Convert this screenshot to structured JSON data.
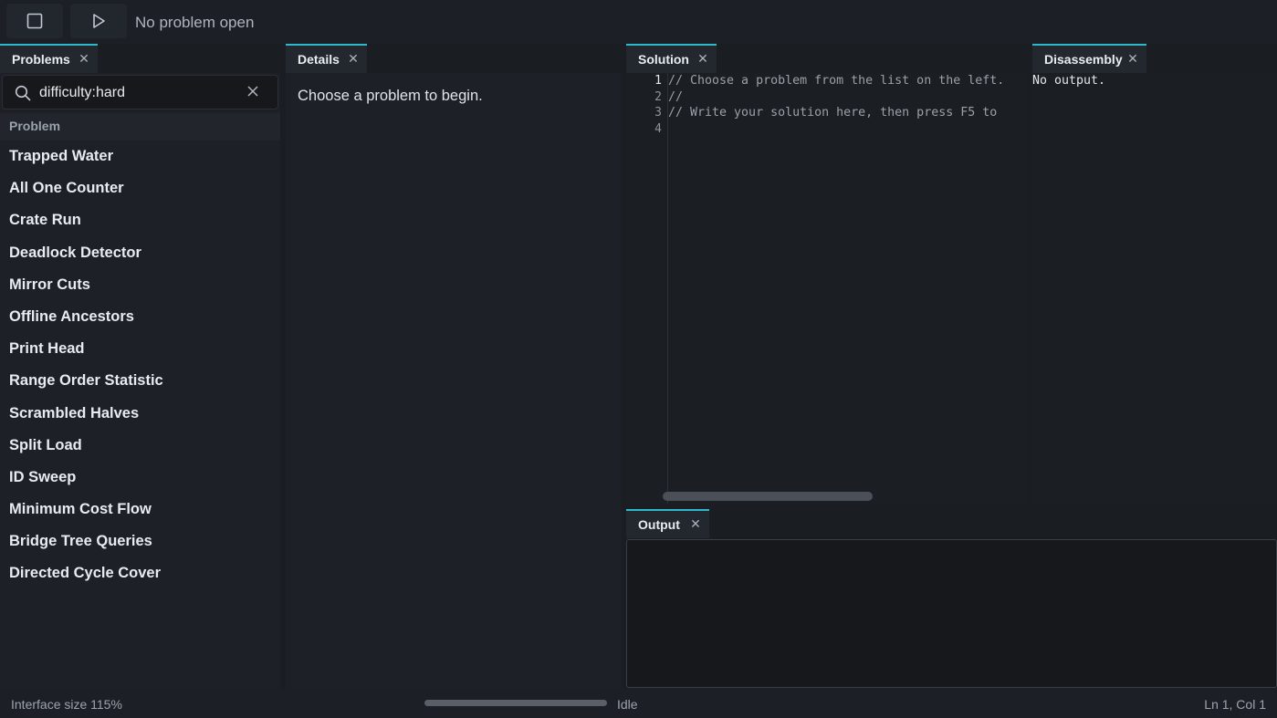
{
  "toolbar": {
    "stop_icon": "stop-square-icon",
    "run_icon": "play-icon",
    "status": "No problem open"
  },
  "problems": {
    "tab_label": "Problems",
    "search_value": "difficulty:hard",
    "column_header": "Problem",
    "items": [
      "Trapped Water",
      "All One Counter",
      "Crate Run",
      "Deadlock Detector",
      "Mirror Cuts",
      "Offline Ancestors",
      "Print Head",
      "Range Order Statistic",
      "Scrambled Halves",
      "Split Load",
      "ID Sweep",
      "Minimum Cost Flow",
      "Bridge Tree Queries",
      "Directed Cycle Cover"
    ]
  },
  "details": {
    "tab_label": "Details",
    "message": "Choose a problem to begin."
  },
  "solution": {
    "tab_label": "Solution",
    "lines": [
      "// Choose a problem from the list on the left.",
      "//",
      "// Write your solution here, then press F5 to",
      ""
    ]
  },
  "disassembly": {
    "tab_label": "Disassembly",
    "text": "No output."
  },
  "output": {
    "tab_label": "Output"
  },
  "statusbar": {
    "interface_size": "Interface size 115%",
    "state": "Idle",
    "cursor": "Ln 1, Col 1"
  },
  "colors": {
    "accent": "#2fb8c9",
    "background": "#1a1d22",
    "panel": "#1d2026"
  }
}
